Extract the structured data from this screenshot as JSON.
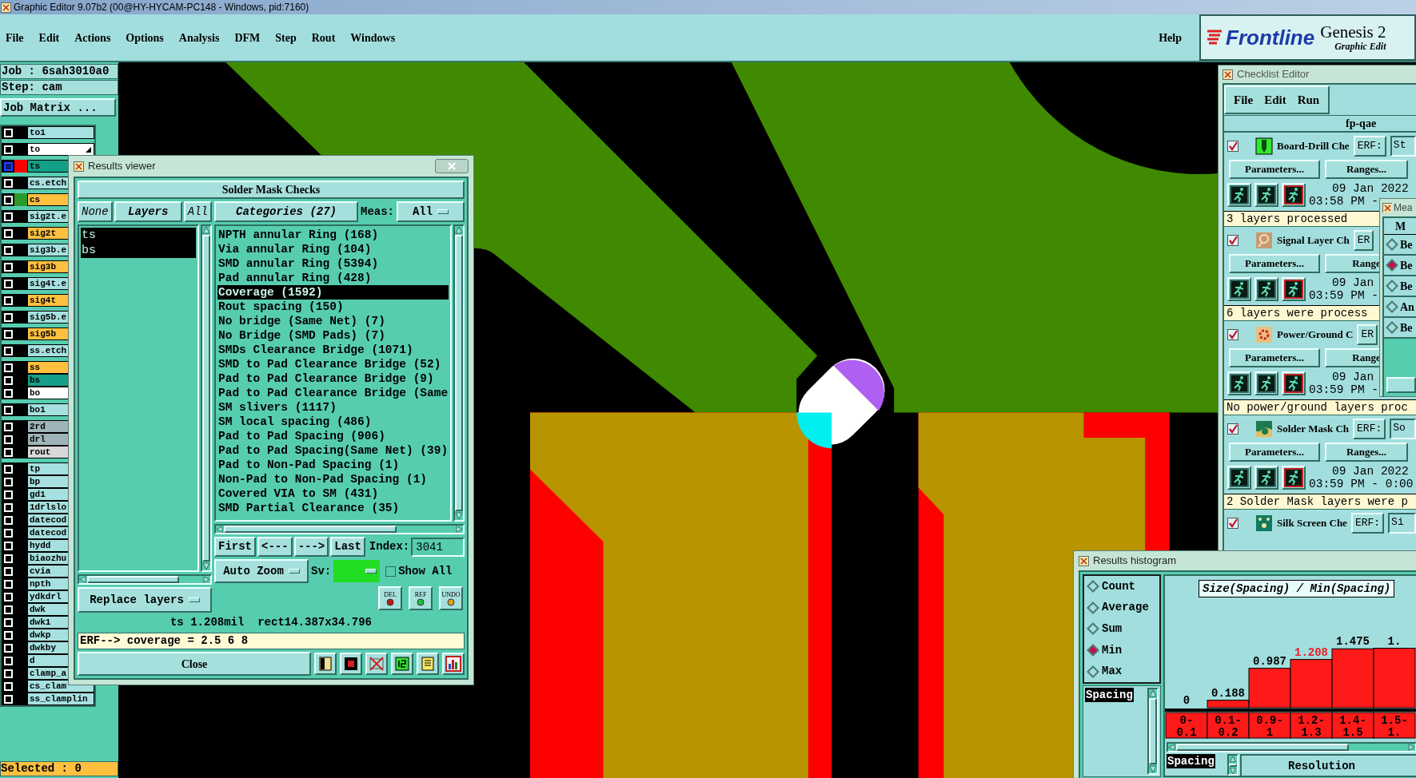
{
  "title_bar": {
    "title": "Graphic Editor 9.07b2 (00@HY-HYCAM-PC148 - Windows, pid:7160)"
  },
  "menu": [
    "File",
    "Edit",
    "Actions",
    "Options",
    "Analysis",
    "DFM",
    "Step",
    "Rout",
    "Windows"
  ],
  "help": "Help",
  "logo": {
    "brand": "Frontline",
    "product": "Genesis 2",
    "subtitle": "Graphic Edit"
  },
  "job_panel": {
    "job": "Job : 6sah3010a0",
    "step": "Step: cam",
    "matrix_button": "Job Matrix ...",
    "selected_count": "Selected : 0",
    "layer_groups": [
      [
        {
          "name": "to1",
          "color": "#a6e0e0",
          "selected": false,
          "pointer": false
        }
      ],
      [
        {
          "name": "to",
          "color": "#ffffff",
          "selected": false,
          "pointer": true
        }
      ],
      [
        {
          "name": "ts",
          "color": "#14a088",
          "selected": true,
          "pointer": false,
          "swatch": {
            "color": "#ff0000"
          }
        }
      ],
      [
        {
          "name": "cs.etch",
          "color": "#a6e0e0",
          "selected": false,
          "pointer": false
        }
      ],
      [
        {
          "name": "cs",
          "color": "#ffc040",
          "selected": false,
          "pointer": false,
          "swatch": {
            "color": "#2a9a2a"
          }
        }
      ],
      [
        {
          "name": "sig2t.e",
          "color": "#a6e0e0",
          "selected": false,
          "pointer": false
        }
      ],
      [
        {
          "name": "sig2t",
          "color": "#ffc040",
          "selected": false,
          "pointer": false
        }
      ],
      [
        {
          "name": "sig3b.e",
          "color": "#a6e0e0",
          "selected": false,
          "pointer": false
        }
      ],
      [
        {
          "name": "sig3b",
          "color": "#ffc040",
          "selected": false,
          "pointer": false
        }
      ],
      [
        {
          "name": "sig4t.e",
          "color": "#a6e0e0",
          "selected": false,
          "pointer": false
        }
      ],
      [
        {
          "name": "sig4t",
          "color": "#ffc040",
          "selected": false,
          "pointer": false
        }
      ],
      [
        {
          "name": "sig5b.e",
          "color": "#a6e0e0",
          "selected": false,
          "pointer": false
        }
      ],
      [
        {
          "name": "sig5b",
          "color": "#ffc040",
          "selected": false,
          "pointer": false
        }
      ],
      [
        {
          "name": "ss.etch",
          "color": "#a6e0e0",
          "selected": false,
          "pointer": false
        }
      ],
      [
        {
          "name": "ss",
          "color": "#ffc040",
          "selected": false,
          "pointer": false
        },
        {
          "name": "bs",
          "color": "#14a088",
          "selected": false,
          "pointer": false
        },
        {
          "name": "bo",
          "color": "#ffffff",
          "selected": false,
          "pointer": false
        }
      ],
      [
        {
          "name": "bo1",
          "color": "#a6e0e0",
          "selected": false,
          "pointer": false
        }
      ],
      [
        {
          "name": "2rd",
          "color": "#9fb4b8",
          "selected": false,
          "pointer": false
        },
        {
          "name": "drl",
          "color": "#9fb4b8",
          "selected": false,
          "pointer": false
        },
        {
          "name": "rout",
          "color": "#d8d8d8",
          "selected": false,
          "pointer": false
        }
      ],
      [
        {
          "name": "tp",
          "color": "#a6e0e0",
          "selected": false,
          "pointer": false
        },
        {
          "name": "bp",
          "color": "#a6e0e0",
          "selected": false,
          "pointer": false
        },
        {
          "name": "gd1",
          "color": "#a6e0e0",
          "selected": false,
          "pointer": false
        },
        {
          "name": "1drlslo",
          "color": "#a6e0e0",
          "selected": false,
          "pointer": false
        },
        {
          "name": "datecod",
          "color": "#a6e0e0",
          "selected": false,
          "pointer": false
        },
        {
          "name": "datecod",
          "color": "#a6e0e0",
          "selected": false,
          "pointer": false
        },
        {
          "name": "hydd",
          "color": "#a6e0e0",
          "selected": false,
          "pointer": false
        },
        {
          "name": "biaozhu",
          "color": "#a6e0e0",
          "selected": false,
          "pointer": false
        },
        {
          "name": "cvia",
          "color": "#a6e0e0",
          "selected": false,
          "pointer": false
        },
        {
          "name": "npth",
          "color": "#a6e0e0",
          "selected": false,
          "pointer": false
        },
        {
          "name": "ydkdrl",
          "color": "#a6e0e0",
          "selected": false,
          "pointer": false
        },
        {
          "name": "dwk",
          "color": "#a6e0e0",
          "selected": false,
          "pointer": false
        },
        {
          "name": "dwk1",
          "color": "#a6e0e0",
          "selected": false,
          "pointer": false
        },
        {
          "name": "dwkp",
          "color": "#a6e0e0",
          "selected": false,
          "pointer": false
        },
        {
          "name": "dwkby",
          "color": "#a6e0e0",
          "selected": false,
          "pointer": false
        },
        {
          "name": "d",
          "color": "#a6e0e0",
          "selected": false,
          "pointer": false
        },
        {
          "name": "clamp_a",
          "color": "#a6e0e0",
          "selected": false,
          "pointer": false
        },
        {
          "name": "cs_clam",
          "color": "#a6e0e0",
          "selected": false,
          "pointer": false
        },
        {
          "name": "ss_clamplin",
          "color": "#a6e0e0",
          "selected": false,
          "pointer": false
        }
      ]
    ]
  },
  "results_viewer": {
    "title": "Results viewer",
    "header": "Solder Mask Checks",
    "layer_buttons": [
      "None",
      "Layers",
      "All"
    ],
    "layers": [
      {
        "name": "ts",
        "selected": true
      },
      {
        "name": "bs",
        "selected": true
      }
    ],
    "replace_button": "Replace layers",
    "categories_button": "Categories (27)",
    "meas_label": "Meas:",
    "meas_value": "All",
    "categories": [
      {
        "label": "NPTH annular Ring (168)",
        "selected": false
      },
      {
        "label": "Via annular Ring (104)",
        "selected": false
      },
      {
        "label": "SMD annular Ring (5394)",
        "selected": false
      },
      {
        "label": "Pad annular Ring (428)",
        "selected": false
      },
      {
        "label": "Coverage (1592)",
        "selected": true
      },
      {
        "label": "Rout spacing (150)",
        "selected": false
      },
      {
        "label": "No bridge (Same Net) (7)",
        "selected": false
      },
      {
        "label": "No Bridge (SMD Pads) (7)",
        "selected": false
      },
      {
        "label": "SMDs Clearance Bridge (1071)",
        "selected": false
      },
      {
        "label": "SMD to Pad Clearance Bridge (52)",
        "selected": false
      },
      {
        "label": "Pad to Pad Clearance Bridge (9)",
        "selected": false
      },
      {
        "label": "Pad to Pad Clearance Bridge (Same",
        "selected": false
      },
      {
        "label": "SM slivers (1117)",
        "selected": false
      },
      {
        "label": "SM local spacing (486)",
        "selected": false
      },
      {
        "label": "Pad to Pad Spacing (906)",
        "selected": false
      },
      {
        "label": "Pad to Pad Spacing(Same Net) (39)",
        "selected": false
      },
      {
        "label": "Pad to Non-Pad Spacing (1)",
        "selected": false
      },
      {
        "label": "Non-Pad to Non-Pad Spacing (1)",
        "selected": false
      },
      {
        "label": "Covered VIA to SM (431)",
        "selected": false
      },
      {
        "label": "SMD Partial Clearance (35)",
        "selected": false
      }
    ],
    "nav": [
      "First",
      "<---",
      "--->",
      "Last"
    ],
    "index_label": "Index:",
    "index_value": "3041",
    "auto_zoom": "Auto Zoom",
    "sv": {
      "label": "Sv:",
      "color": "#22dd22"
    },
    "show_all": {
      "label": "Show All",
      "checked": false
    },
    "tools": [
      "DEL",
      "REF",
      "UNDO"
    ],
    "status": "ts 1.208mil  rect14.387x34.796",
    "erf": "ERF--> coverage = 2.5 6 8",
    "close": "Close"
  },
  "checklist_editor": {
    "title": "Checklist Editor",
    "menu": [
      "File",
      "Edit",
      "Run"
    ],
    "name": "fp-qae",
    "checks": [
      {
        "kind": "drill",
        "name": "Board-Drill Che",
        "checked": true,
        "erf": "ERF:",
        "erf_value": "St",
        "parameters": "Parameters...",
        "ranges": "Ranges...",
        "date": "09 Jan 2022",
        "time": "03:58 PM -",
        "message": "3 layers processed"
      },
      {
        "kind": "signal",
        "name": "Signal Layer Ch",
        "checked": true,
        "erf": "ER",
        "parameters": "Parameters...",
        "ranges": "Range",
        "date": "09 Jan",
        "time": "03:59 PM -",
        "message": "6 layers were process"
      },
      {
        "kind": "power",
        "name": "Power/Ground C",
        "checked": true,
        "erf": "ER",
        "parameters": "Parameters...",
        "ranges": "Range",
        "date": "09 Jan",
        "time": "03:59 PM -",
        "message": "No power/ground layers proc"
      },
      {
        "kind": "mask",
        "name": "Solder Mask Ch",
        "checked": true,
        "erf": "ERF:",
        "erf_value": "So",
        "parameters": "Parameters...",
        "ranges": "Ranges...",
        "date": "09 Jan 2022",
        "time": "03:59 PM - 0:00",
        "message": "2 Solder Mask layers were p"
      },
      {
        "kind": "silk",
        "name": "Silk Screen Che",
        "checked": true,
        "erf": "ERF:",
        "erf_value": "Si"
      }
    ]
  },
  "measure_window": {
    "title": "Mea",
    "header": "M",
    "options": [
      {
        "label": "Be",
        "selected": false
      },
      {
        "label": "Be",
        "selected": true
      },
      {
        "label": "Be",
        "selected": false
      },
      {
        "label": "An",
        "selected": false
      },
      {
        "label": "Be",
        "selected": false
      }
    ]
  },
  "histogram": {
    "title": "Results histogram",
    "modes": [
      {
        "label": "Count",
        "selected": false
      },
      {
        "label": "Average",
        "selected": false
      },
      {
        "label": "Sum",
        "selected": false
      },
      {
        "label": "Min",
        "selected": true
      },
      {
        "label": "Max",
        "selected": false
      }
    ],
    "fields": [
      {
        "label": "Spacing",
        "selected": true
      }
    ],
    "chart_data": {
      "type": "bar",
      "title": "Size(Spacing) / Min(Spacing)",
      "categories": [
        "0-0.1",
        "0.1-0.2",
        "0.9-1",
        "1.2-1.3",
        "1.4-1.5",
        "1.5-1."
      ],
      "values": [
        0,
        0.188,
        0.987,
        1.208,
        1.475,
        1.49
      ],
      "value_labels": [
        "0",
        "0.188",
        "0.987",
        "1.208",
        "1.475",
        "1."
      ]
    },
    "bars": [
      {
        "selected": false
      },
      {
        "selected": false
      },
      {
        "selected": false
      },
      {
        "selected": true
      },
      {
        "selected": false
      },
      {
        "selected": false
      }
    ],
    "bottom_fields": [
      {
        "label": "Spacing",
        "selected": true
      }
    ],
    "resolution_label": "Resolution"
  }
}
